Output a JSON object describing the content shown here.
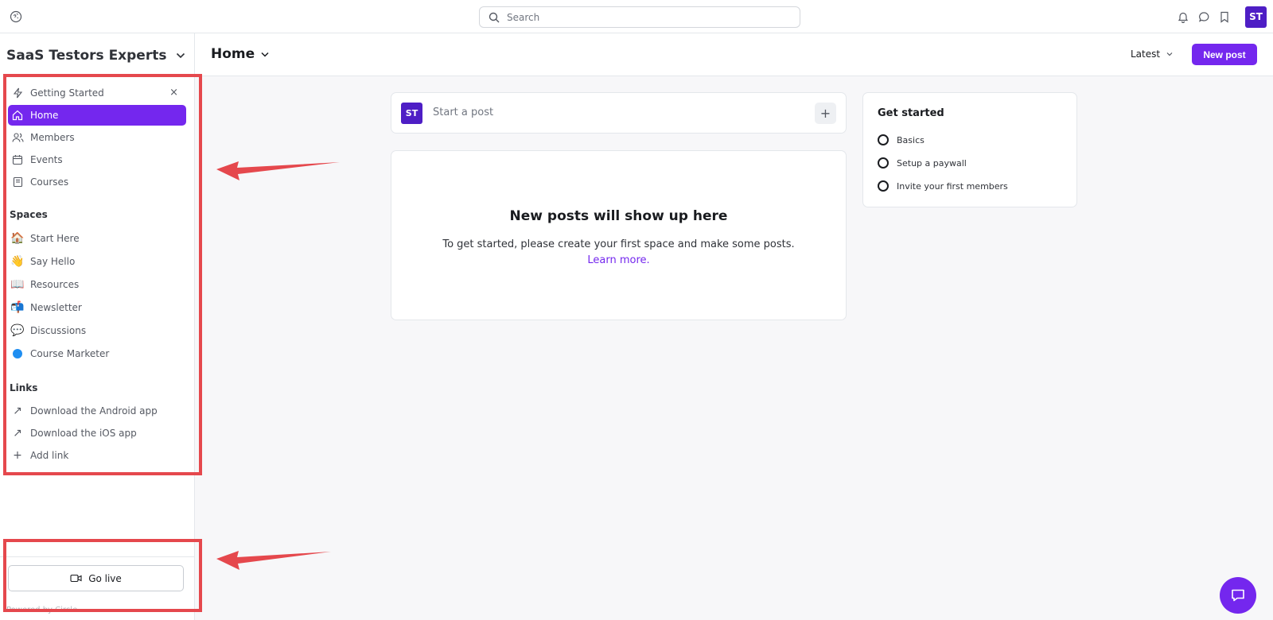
{
  "topbar": {
    "search_placeholder": "Search",
    "avatar_initials": "ST"
  },
  "sidebar": {
    "community_name": "SaaS Testors Experts",
    "getting_started": "Getting Started",
    "close_symbol": "×",
    "nav": [
      {
        "label": "Home",
        "icon": "home-icon",
        "active": true
      },
      {
        "label": "Members",
        "icon": "members-icon"
      },
      {
        "label": "Events",
        "icon": "calendar-icon"
      },
      {
        "label": "Courses",
        "icon": "courses-icon"
      }
    ],
    "spaces_title": "Spaces",
    "spaces": [
      {
        "label": "Start Here",
        "emoji": "🏠"
      },
      {
        "label": "Say Hello",
        "emoji": "👋"
      },
      {
        "label": "Resources",
        "emoji": "📖"
      },
      {
        "label": "Newsletter",
        "emoji": "📬"
      },
      {
        "label": "Discussions",
        "emoji": "💬"
      },
      {
        "label": "Course Marketer",
        "icon": "blue-dot-icon"
      }
    ],
    "links_title": "Links",
    "links": [
      {
        "label": "Download the Android app",
        "symbol": "↗"
      },
      {
        "label": "Download the iOS app",
        "symbol": "↗"
      },
      {
        "label": "Add link",
        "symbol": "+"
      }
    ],
    "go_live_label": "Go live",
    "powered_by": "Powered by Circle"
  },
  "header": {
    "title": "Home",
    "sort_label": "Latest",
    "new_post_label": "New post"
  },
  "composer": {
    "avatar_initials": "ST",
    "placeholder": "Start a post",
    "plus_symbol": "+"
  },
  "empty_state": {
    "title": "New posts will show up here",
    "body": "To get started, please create your first space and make some posts.",
    "link": "Learn more."
  },
  "get_started": {
    "title": "Get started",
    "items": [
      "Basics",
      "Setup a paywall",
      "Invite your first members"
    ]
  },
  "colors": {
    "accent": "#7427ee",
    "avatar": "#4e1ec5",
    "annotation": "#e5484d"
  }
}
